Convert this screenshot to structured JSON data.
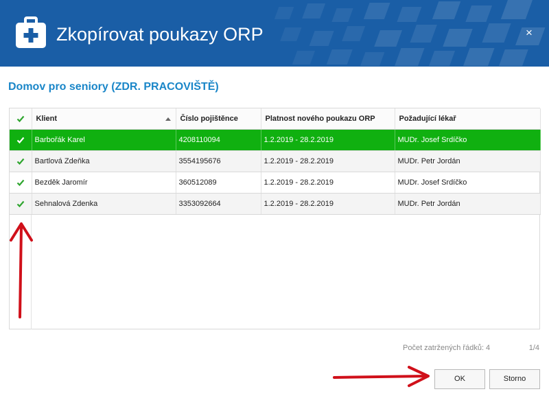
{
  "dialog": {
    "title": "Zkopírovat poukazy ORP",
    "close_label": "×"
  },
  "subtitle": "Domov pro seniory (ZDR. PRACOVIŠTĚ)",
  "table": {
    "columns": [
      "Klient",
      "Číslo pojištěnce",
      "Platnost nového poukazu ORP",
      "Požadující lékař"
    ],
    "rows": [
      {
        "klient": "Barbořák Karel",
        "cislo": "4208110094",
        "platnost": "1.2.2019 - 28.2.2019",
        "lekar": "MUDr. Josef Srdíčko",
        "selected": true
      },
      {
        "klient": "Bartlová Zdeňka",
        "cislo": "3554195676",
        "platnost": "1.2.2019 - 28.2.2019",
        "lekar": "MUDr. Petr Jordán",
        "selected": false
      },
      {
        "klient": "Bezděk Jaromír",
        "cislo": "360512089",
        "platnost": "1.2.2019 - 28.2.2019",
        "lekar": "MUDr. Josef Srdíčko",
        "selected": false
      },
      {
        "klient": "Sehnalová Zdenka",
        "cislo": "3353092664",
        "platnost": "1.2.2019 - 28.2.2019",
        "lekar": "MUDr. Petr Jordán",
        "selected": false
      }
    ]
  },
  "footer": {
    "count_text": "Počet zatržených řádků: 4",
    "page_text": "1/4"
  },
  "buttons": {
    "ok": "OK",
    "cancel": "Storno"
  },
  "colors": {
    "header": "#1a5ea6",
    "accent": "#1a86c8",
    "selected_row": "#10b010",
    "check": "#2ea52e",
    "annotation_arrow": "#d0101a"
  }
}
